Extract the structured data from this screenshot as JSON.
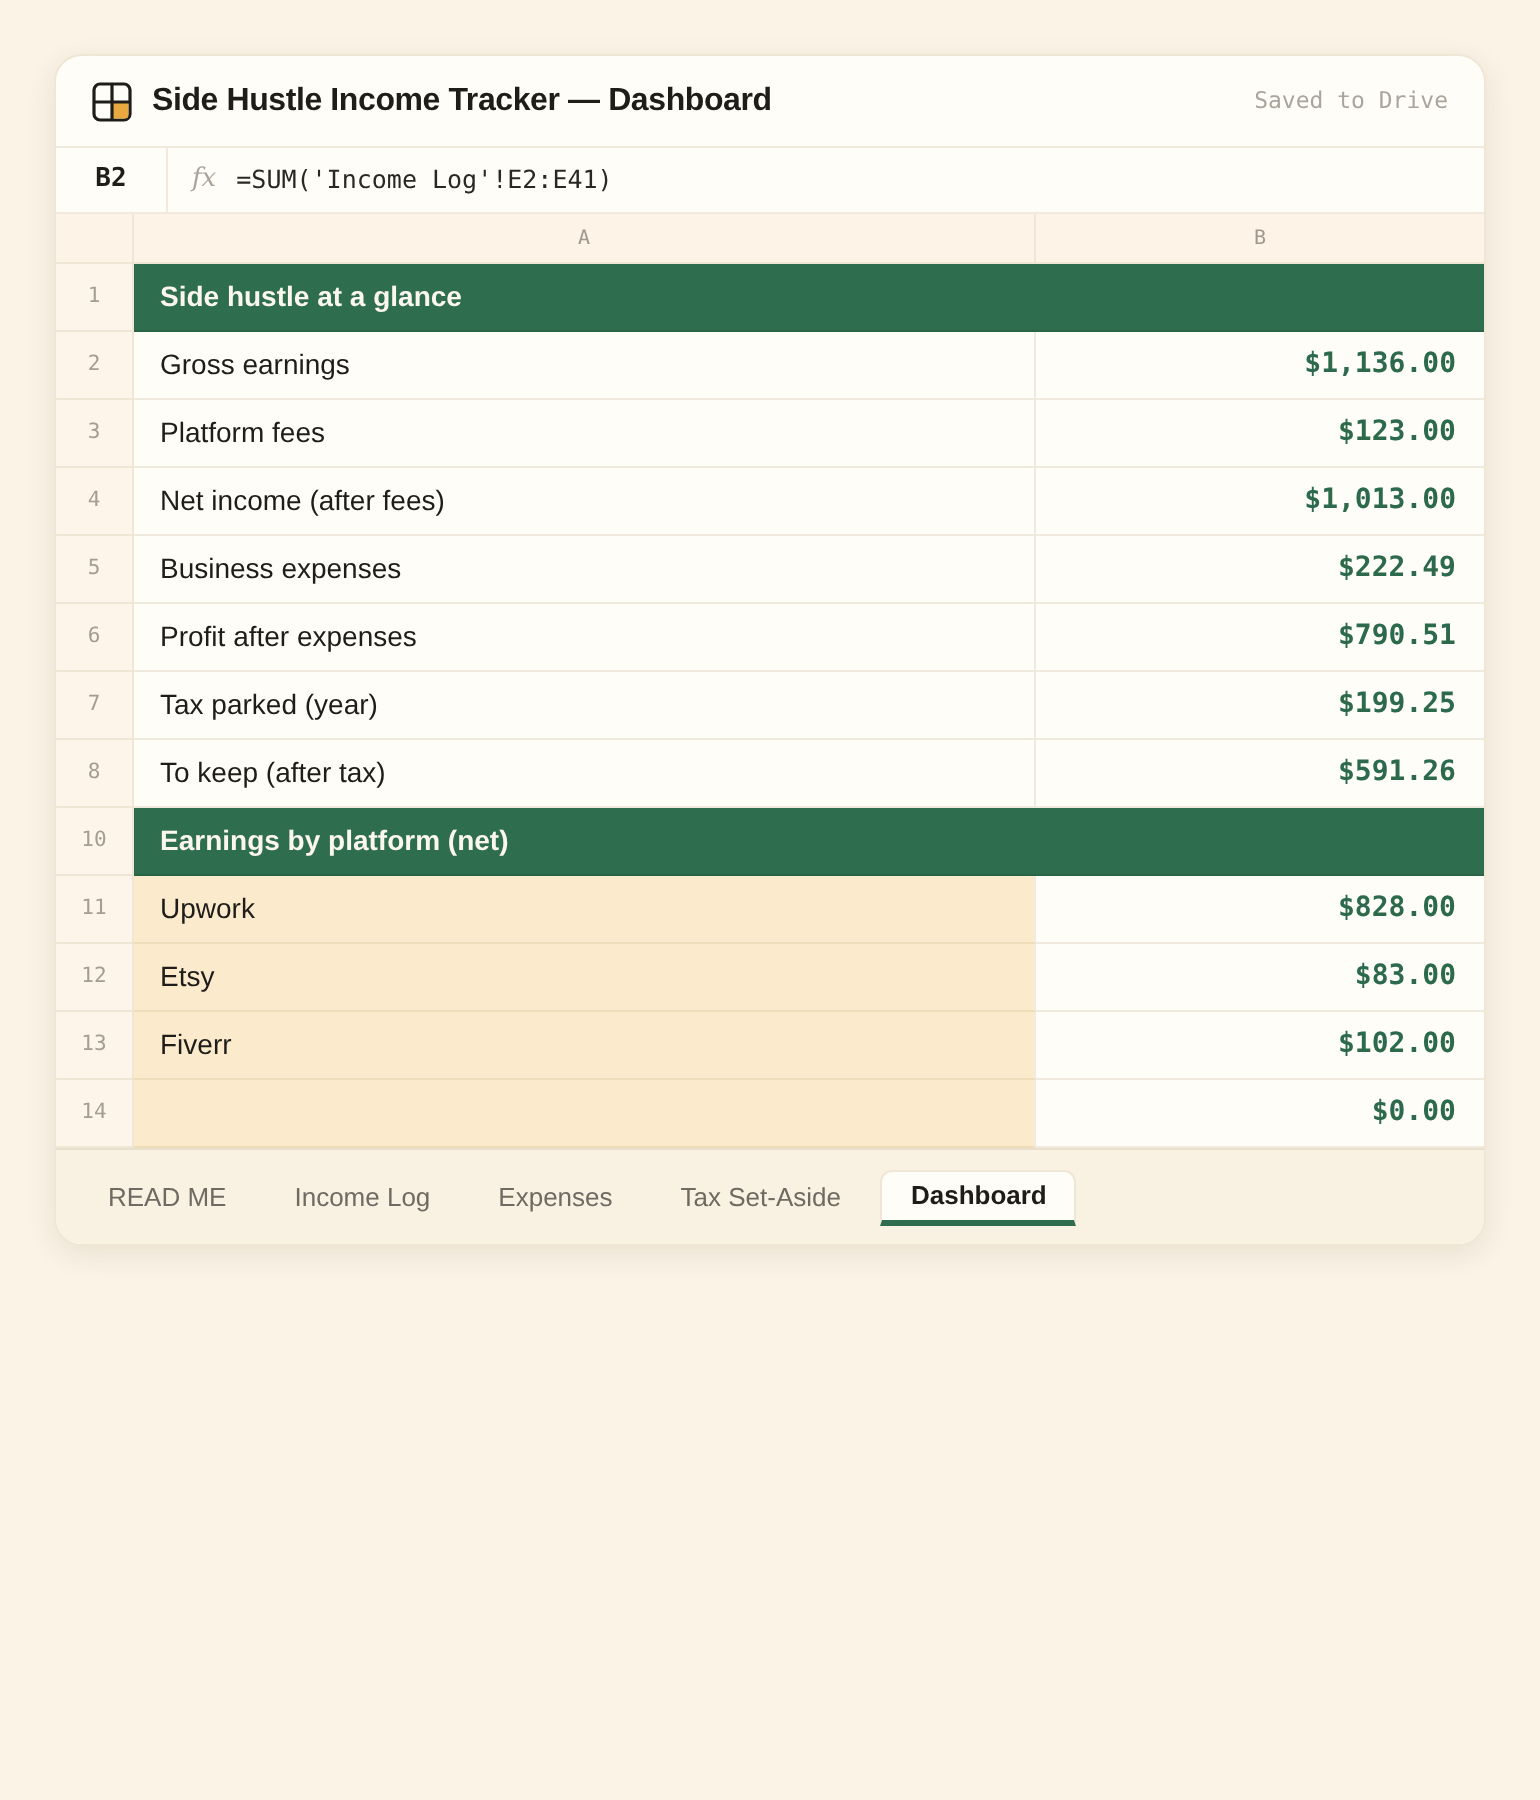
{
  "window": {
    "title": "Side Hustle Income Tracker — Dashboard",
    "status": "Saved to Drive"
  },
  "formula_bar": {
    "cell": "B2",
    "fx_label": "fx",
    "formula": "=SUM('Income Log'!E2:E41)"
  },
  "columns": [
    "A",
    "B"
  ],
  "rows": [
    {
      "number": "1",
      "kind": "section",
      "label": "Side hustle at a glance"
    },
    {
      "number": "2",
      "kind": "data",
      "label": "Gross earnings",
      "value": "$1,136.00",
      "highlighted": false
    },
    {
      "number": "3",
      "kind": "data",
      "label": "Platform fees",
      "value": "$123.00",
      "highlighted": false
    },
    {
      "number": "4",
      "kind": "data",
      "label": "Net income (after fees)",
      "value": "$1,013.00",
      "highlighted": false
    },
    {
      "number": "5",
      "kind": "data",
      "label": "Business expenses",
      "value": "$222.49",
      "highlighted": false
    },
    {
      "number": "6",
      "kind": "data",
      "label": "Profit after expenses",
      "value": "$790.51",
      "highlighted": false
    },
    {
      "number": "7",
      "kind": "data",
      "label": "Tax parked (year)",
      "value": "$199.25",
      "highlighted": false
    },
    {
      "number": "8",
      "kind": "data",
      "label": "To keep (after tax)",
      "value": "$591.26",
      "highlighted": false
    },
    {
      "number": "10",
      "kind": "section",
      "label": "Earnings by platform (net)"
    },
    {
      "number": "11",
      "kind": "data",
      "label": "Upwork",
      "value": "$828.00",
      "highlighted": true
    },
    {
      "number": "12",
      "kind": "data",
      "label": "Etsy",
      "value": "$83.00",
      "highlighted": true
    },
    {
      "number": "13",
      "kind": "data",
      "label": "Fiverr",
      "value": "$102.00",
      "highlighted": true
    },
    {
      "number": "14",
      "kind": "data",
      "value": "$0.00",
      "highlighted": true
    }
  ],
  "sheet_tabs": [
    {
      "label": "READ ME",
      "selected": false
    },
    {
      "label": "Income Log",
      "selected": false
    },
    {
      "label": "Expenses",
      "selected": false
    },
    {
      "label": "Tax Set-Aside",
      "selected": false
    },
    {
      "label": "Dashboard",
      "selected": true
    }
  ]
}
